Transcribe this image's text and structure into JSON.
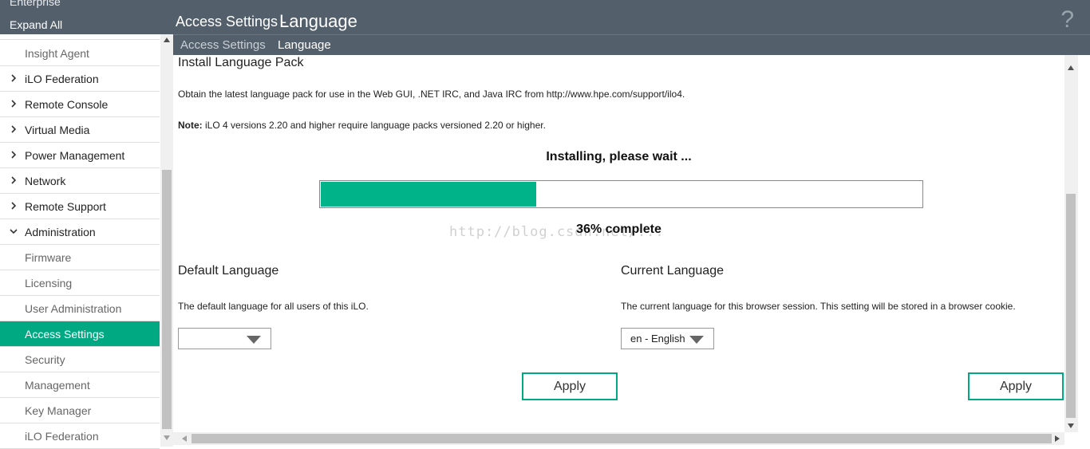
{
  "sidebar": {
    "enterprise_label": "Enterprise",
    "expand_all": "Expand All",
    "items": [
      {
        "label": "Insight Agent",
        "kind": "sub"
      },
      {
        "label": "iLO Federation",
        "kind": "collapsed"
      },
      {
        "label": "Remote Console",
        "kind": "collapsed"
      },
      {
        "label": "Virtual Media",
        "kind": "collapsed"
      },
      {
        "label": "Power Management",
        "kind": "collapsed"
      },
      {
        "label": "Network",
        "kind": "collapsed"
      },
      {
        "label": "Remote Support",
        "kind": "collapsed"
      },
      {
        "label": "Administration",
        "kind": "expanded"
      },
      {
        "label": "Firmware",
        "kind": "sub"
      },
      {
        "label": "Licensing",
        "kind": "sub"
      },
      {
        "label": "User Administration",
        "kind": "sub"
      },
      {
        "label": "Access Settings",
        "kind": "active"
      },
      {
        "label": "Security",
        "kind": "sub"
      },
      {
        "label": "Management",
        "kind": "sub"
      },
      {
        "label": "Key Manager",
        "kind": "sub"
      },
      {
        "label": "iLO Federation",
        "kind": "sub"
      }
    ]
  },
  "header": {
    "title_prefix": "Access Settings - ",
    "title_main": "Language",
    "help_icon": "question-mark-icon",
    "help_glyph": "?"
  },
  "breadcrumb": {
    "parent": "Access Settings",
    "current": "Language"
  },
  "main": {
    "section_title": "Install Language Pack",
    "obtain_text": "Obtain the latest language pack for use in the Web GUI, .NET IRC, and Java IRC from http://www.hpe.com/support/ilo4.",
    "note_label": "Note:",
    "note_text": " iLO 4 versions 2.20 and higher require language packs versioned 2.20 or higher.",
    "installing_text": "Installing, please wait ...",
    "progress_percent": 36,
    "progress_text": "36% complete",
    "watermark": "http://blog.csdn.net/..."
  },
  "default_language": {
    "title": "Default Language",
    "description": "The default language for all users of this iLO.",
    "selected": "",
    "apply_label": "Apply"
  },
  "current_language": {
    "title": "Current Language",
    "description": "The current language for this browser session. This setting will be stored in a browser cookie.",
    "selected": "en - English",
    "apply_label": "Apply"
  },
  "colors": {
    "header_bg": "#535f6b",
    "accent": "#00a982",
    "progress_fill": "#00b388"
  }
}
